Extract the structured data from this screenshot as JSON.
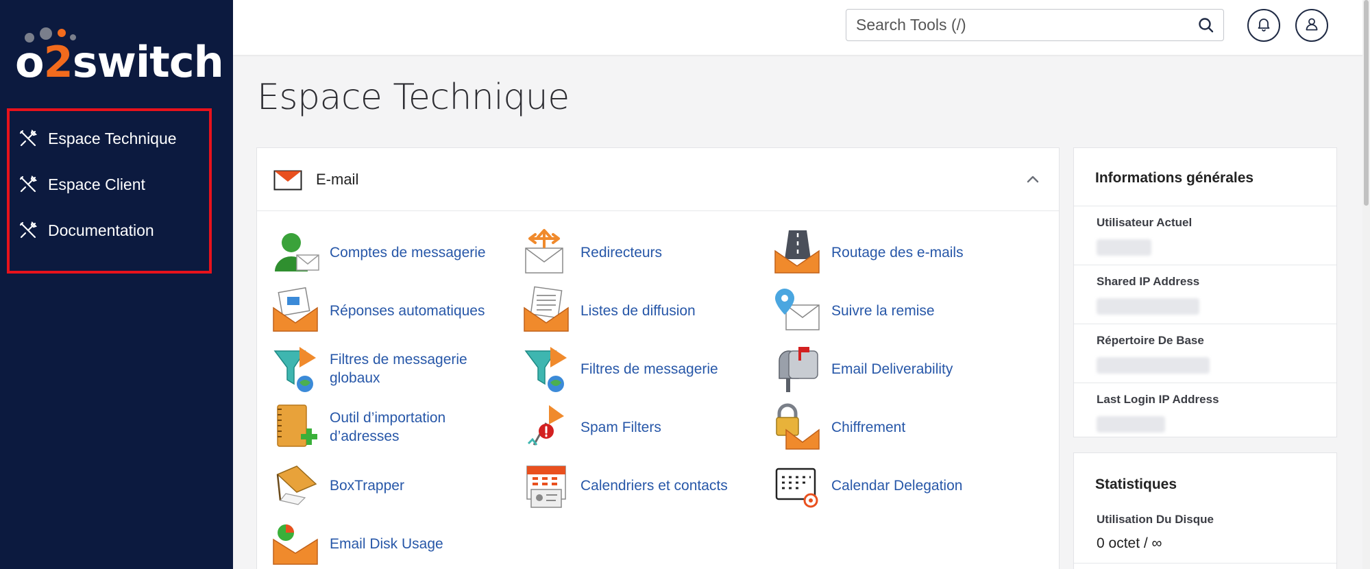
{
  "brand": {
    "logo_prefix": "o",
    "logo_two": "2",
    "logo_suffix": "switch",
    "accent": "#f26b1d",
    "sidebar_bg": "#0c1a3f"
  },
  "sidebar": {
    "items": [
      {
        "label": "Espace Technique",
        "icon": "tools-icon"
      },
      {
        "label": "Espace Client",
        "icon": "tools-icon"
      },
      {
        "label": "Documentation",
        "icon": "tools-icon"
      }
    ]
  },
  "header": {
    "search_placeholder": "Search Tools (/)",
    "search_value": ""
  },
  "page": {
    "title": "Espace Technique"
  },
  "email_section": {
    "title": "E-mail",
    "tools": [
      {
        "label": "Comptes de messagerie",
        "icon": "user-mail-icon"
      },
      {
        "label": "Redirecteurs",
        "icon": "forwarder-icon"
      },
      {
        "label": "Routage des e-mails",
        "icon": "routing-icon"
      },
      {
        "label": "Réponses automatiques",
        "icon": "autoresponder-icon"
      },
      {
        "label": "Listes de diffusion",
        "icon": "mailing-list-icon"
      },
      {
        "label": "Suivre la remise",
        "icon": "track-delivery-icon"
      },
      {
        "label": "Filtres de messagerie globaux",
        "icon": "global-filter-icon"
      },
      {
        "label": "Filtres de messagerie",
        "icon": "filter-icon"
      },
      {
        "label": "Email Deliverability",
        "icon": "mailbox-icon"
      },
      {
        "label": "Outil d’importation d’adresses",
        "icon": "address-book-icon"
      },
      {
        "label": "Spam Filters",
        "icon": "spam-icon"
      },
      {
        "label": "Chiffrement",
        "icon": "lock-mail-icon"
      },
      {
        "label": "BoxTrapper",
        "icon": "boxtrapper-icon"
      },
      {
        "label": "Calendriers et contacts",
        "icon": "calendar-contacts-icon"
      },
      {
        "label": "Calendar Delegation",
        "icon": "calendar-gear-icon"
      },
      {
        "label": "Email Disk Usage",
        "icon": "disk-usage-icon"
      }
    ]
  },
  "info": {
    "title": "Informations générales",
    "rows": [
      {
        "label": "Utilisateur Actuel"
      },
      {
        "label": "Shared IP Address"
      },
      {
        "label": "Répertoire De Base"
      },
      {
        "label": "Last Login IP Address"
      }
    ]
  },
  "stats": {
    "title": "Statistiques",
    "disk_label": "Utilisation Du Disque",
    "disk_value": "0 octet / ∞"
  }
}
